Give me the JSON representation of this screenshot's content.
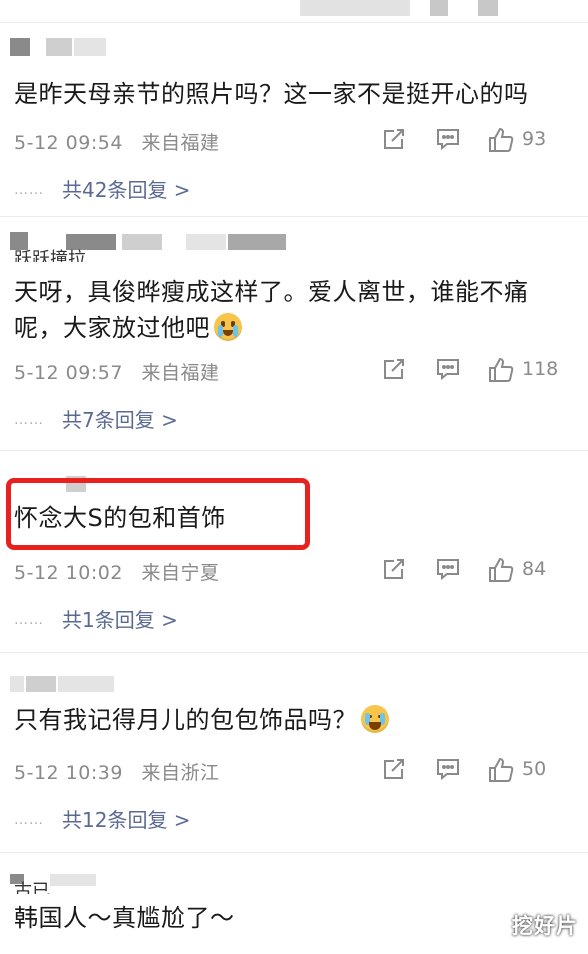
{
  "comments": [
    {
      "text": "是昨天母亲节的照片吗？这一家不是挺开心的吗",
      "date": "5-12 09:54",
      "location": "来自福建",
      "likes": "93",
      "replies": "共42条回复 >"
    },
    {
      "username_partial": "跃跃撞拉",
      "text": "天呀，具俊晔瘦成这样了。爱人离世，谁能不痛呢，大家放过他吧",
      "emoji": "crying-face-emoji",
      "date": "5-12 09:57",
      "location": "来自福建",
      "likes": "118",
      "replies": "共7条回复 >"
    },
    {
      "text": "怀念大S的包和首饰",
      "date": "5-12 10:02",
      "location": "来自宁夏",
      "likes": "84",
      "replies": "共1条回复 >",
      "highlight_color": "#e8211f"
    },
    {
      "text": "只有我记得月儿的包包饰品吗？",
      "emoji": "laughing-tears-emoji",
      "date": "5-12 10:39",
      "location": "来自浙江",
      "likes": "50",
      "replies": "共12条回复 >"
    },
    {
      "username_partial": "古已",
      "text": "韩国人～真尴尬了～"
    }
  ],
  "replies_dots": "……",
  "watermark": "挖好片",
  "colors": {
    "reply_link": "#5b6a92",
    "meta_gray": "#8a8a8a",
    "highlight_red": "#e8211f"
  }
}
